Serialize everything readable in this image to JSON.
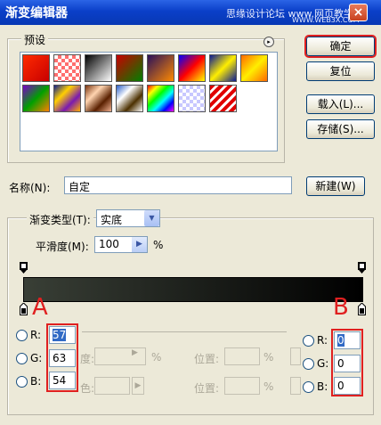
{
  "window": {
    "title": "渐变编辑器",
    "watermark": "思缘设计论坛 www.网页教学网",
    "watermark_small": "WWW.WEB3X.COM",
    "close_label": "×"
  },
  "presets": {
    "label": "预设",
    "menu_icon": "▸",
    "swatches": [
      {
        "name": "fg-to-bg",
        "css": "linear-gradient(135deg,#ff2a00,#c80000)"
      },
      {
        "name": "fg-to-transparent",
        "css": "repeating-conic-gradient(#ff6f6f 0 25%,#fff 0 50%) 0 0/8px 8px"
      },
      {
        "name": "black-white",
        "css": "linear-gradient(135deg,#000,#fff)"
      },
      {
        "name": "red-green",
        "css": "linear-gradient(135deg,#c80000,#008000)"
      },
      {
        "name": "violet-orange",
        "css": "linear-gradient(135deg,#29105b,#ff8a00)"
      },
      {
        "name": "blue-red-yellow",
        "css": "linear-gradient(135deg,#0000ff,#ff0000,#ffff00)"
      },
      {
        "name": "blue-yellow-blue",
        "css": "linear-gradient(135deg,#0a1a96,#ffee00,#0a1a96)"
      },
      {
        "name": "orange-yellow-orange",
        "css": "linear-gradient(135deg,#ff6a00,#ffee00,#ff6a00)"
      },
      {
        "name": "violet-green-orange",
        "css": "linear-gradient(135deg,#7a00c8,#00a000,#ff8000)"
      },
      {
        "name": "yellow-violet-orange-blue",
        "css": "linear-gradient(135deg,#102090,#ffd000,#7a1ab0,#ffb000)"
      },
      {
        "name": "copper",
        "css": "linear-gradient(135deg,#7a3510,#ffd4b0,#5a2000,#f0b090)"
      },
      {
        "name": "chrome",
        "css": "linear-gradient(135deg,#2a5fc8,#fff,#4c3000,#fff)"
      },
      {
        "name": "spectrum",
        "css": "linear-gradient(135deg,#ff0000,#ffff00,#00ff00,#00ffff,#0000ff,#ff00ff)"
      },
      {
        "name": "transparent-rainbow",
        "css": "repeating-conic-gradient(#c8c8ff 0 25%,#fff 0 50%) 0 0/8px 8px, linear-gradient(135deg,#ff0000,#00ff00,#0000ff)"
      },
      {
        "name": "transparent-stripes",
        "css": "repeating-linear-gradient(135deg,#e00000 0 4px,#fff 4px 7px)"
      }
    ]
  },
  "buttons": {
    "ok": "确定",
    "reset": "复位",
    "load": "载入(L)...",
    "save": "存储(S)...",
    "new": "新建(W)"
  },
  "name": {
    "label": "名称(N):",
    "value": "自定"
  },
  "gradient_type": {
    "label": "渐变类型(T):",
    "value": "实底"
  },
  "smoothness": {
    "label": "平滑度(M):",
    "value": "100",
    "unit": "%"
  },
  "gradient_bar": {
    "start_color": "#393f36",
    "end_color": "#000000"
  },
  "annotations": {
    "left_letter": "A",
    "right_letter": "B",
    "highlight_color": "#e02020"
  },
  "stop_left": {
    "r_label": "R:",
    "r_value": "57",
    "g_label": "G:",
    "g_value": "63",
    "b_label": "B:",
    "b_value": "54"
  },
  "stop_right": {
    "r_label": "R:",
    "r_value": "0",
    "g_label": "G:",
    "g_value": "0",
    "b_label": "B:",
    "b_value": "0"
  },
  "stops_section": {
    "opacity_frag": "度:",
    "color_frag": "色:",
    "percent": "%",
    "location_label": "位置:"
  }
}
